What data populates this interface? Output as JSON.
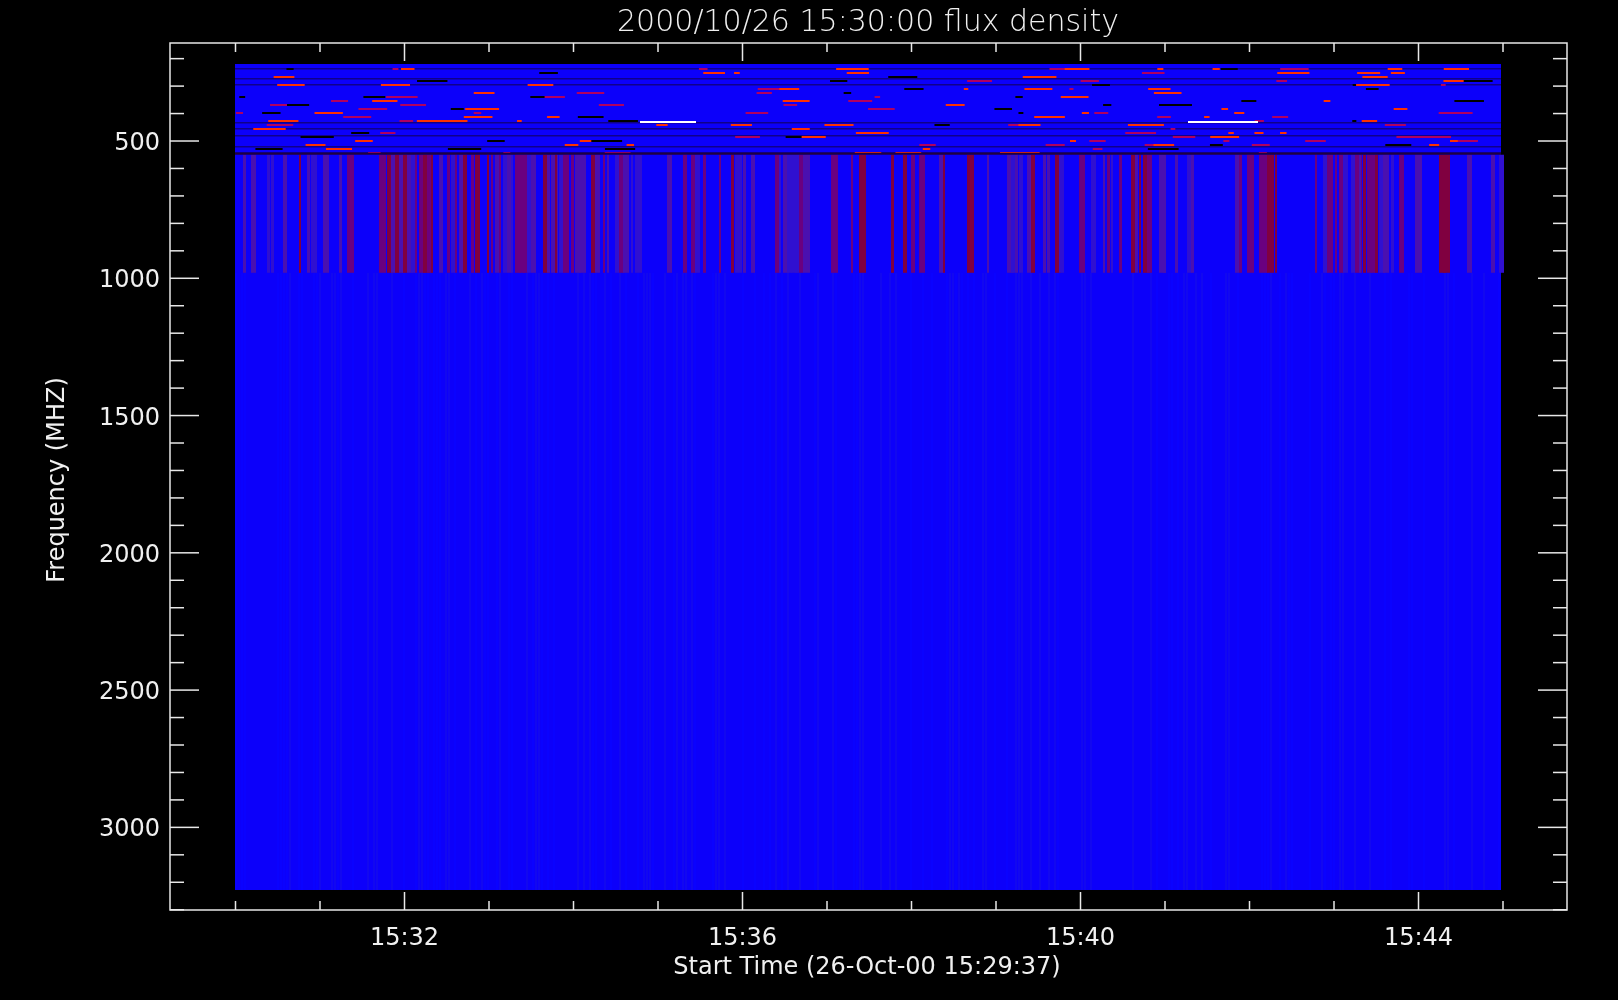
{
  "title": "2000/10/26 15:30:00 flux density",
  "y_axis": {
    "label": "Frequency (MHZ)",
    "tick_labels": [
      "500",
      "1000",
      "1500",
      "2000",
      "2500",
      "3000"
    ]
  },
  "x_axis": {
    "label": "Start Time (26-Oct-00 15:29:37)",
    "tick_labels": [
      "15:32",
      "15:36",
      "15:40",
      "15:44"
    ]
  }
}
